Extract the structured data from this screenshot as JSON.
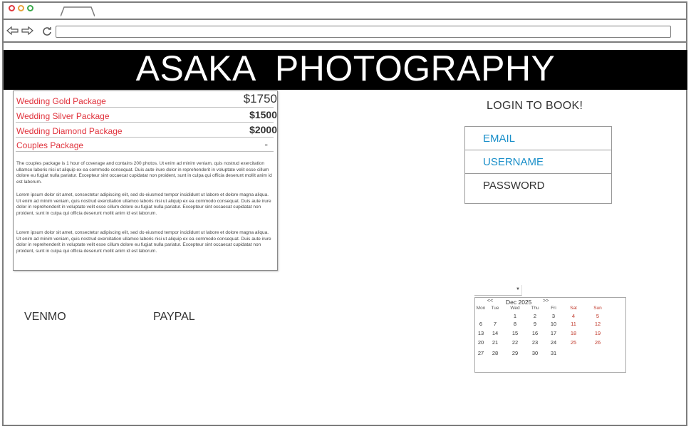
{
  "site": {
    "title": "ASAKA  PHOTOGRAPHY"
  },
  "packages": {
    "rows": [
      {
        "name": "Wedding Gold Package",
        "price": "$1750"
      },
      {
        "name": "Wedding Silver Package",
        "price": "$1500"
      },
      {
        "name": "Wedding Diamond Package",
        "price": "$2000"
      },
      {
        "name": "Couples Package",
        "price": "-"
      }
    ],
    "paragraphs": [
      "The couples package is 1 hour of coverage and contains 200 photos. Ut enim ad minim veniam, quis nostrud exercitation ullamco laboris nisi ut aliquip ex ea commodo consequat. Duis aute irure dolor in reprehenderit in voluptate velit esse cillum dolore eu fugiat nulla pariatur. Excepteur sint occaecat cupidatat non proident, sunt in culpa qui officia deserunt mollit anim id est laborum.",
      "Lorem ipsum dolor sit amet, consectetur adipiscing elit, sed do eiusmod tempor incididunt ut labore et dolore magna aliqua. Ut enim ad minim veniam, quis nostrud exercitation ullamco laboris nisi ut aliquip ex ea commodo consequat. Duis aute irure dolor in reprehenderit in voluptate velit esse cillum dolore eu fugiat nulla pariatur. Excepteur sint occaecat cupidatat non proident, sunt in culpa qui officia deserunt mollit anim id est laborum.",
      "Lorem ipsum dolor sit amet, consectetur adipiscing elit, sed do eiusmod tempor incididunt ut labore et dolore magna aliqua. Ut enim ad minim veniam, quis nostrud exercitation ullamco laboris nisi ut aliquip ex ea commodo consequat. Duis aute irure dolor in reprehenderit in voluptate velit esse cillum dolore eu fugiat nulla pariatur. Excepteur sint occaecat cupidatat non proident, sunt in culpa qui officia deserunt mollit anim id est laborum."
    ]
  },
  "payment": {
    "venmo": "VENMO",
    "paypal": "PAYPAL"
  },
  "login": {
    "title": "LOGIN TO BOOK!",
    "fields": {
      "email": "EMAIL",
      "username": "USERNAME",
      "password": "PASSWORD"
    }
  },
  "calendar": {
    "select_value": "",
    "prev": "<<",
    "next": ">>",
    "month": "Dec 2025",
    "dow": [
      "Mon",
      "Tue",
      "Wed",
      "Thu",
      "Fri",
      "Sat",
      "Sun"
    ],
    "weeks": [
      [
        "",
        "",
        "1",
        "2",
        "3",
        "4",
        "5"
      ],
      [
        "6",
        "7",
        "8",
        "9",
        "10",
        "11",
        "12"
      ],
      [
        "13",
        "14",
        "15",
        "16",
        "17",
        "18",
        "19"
      ],
      [
        "20",
        "21",
        "22",
        "23",
        "24",
        "25",
        "26"
      ],
      [
        "27",
        "28",
        "29",
        "30",
        "31",
        "",
        ""
      ]
    ]
  },
  "colors": {
    "accent_red": "#e0323c",
    "field_blue": "#1a8fc9",
    "header_bg": "#000000"
  },
  "icons": [
    "close-dot-icon",
    "minimize-dot-icon",
    "maximize-dot-icon",
    "back-arrow-icon",
    "forward-arrow-icon",
    "refresh-icon",
    "dropdown-arrow-icon"
  ]
}
